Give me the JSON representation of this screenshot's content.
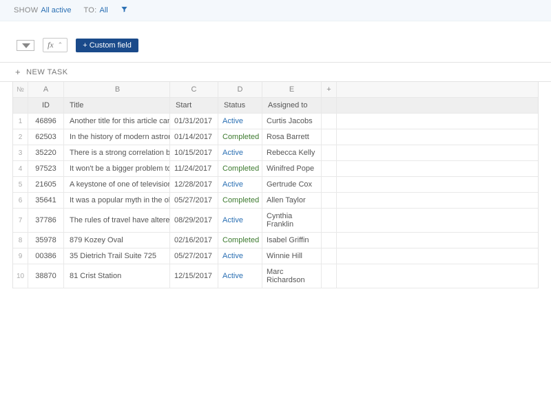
{
  "filters": {
    "show_label": "SHOW",
    "show_value": "All active",
    "to_label": "TO:",
    "to_value": "All"
  },
  "toolbar": {
    "fx_label": "fx",
    "custom_field_btn": "+ Custom field"
  },
  "new_task": {
    "label": "NEW TASK"
  },
  "headers": {
    "num": "№",
    "id": "ID",
    "title": "Title",
    "start": "Start",
    "status": "Status",
    "assigned": "Assigned to"
  },
  "letters": {
    "a": "A",
    "b": "B",
    "c": "C",
    "d": "D",
    "e": "E",
    "plus": "+"
  },
  "rows": [
    {
      "n": "1",
      "id": "46896",
      "title": "Another title for this article can",
      "start": "01/31/2017",
      "status": "Active",
      "assigned": "Curtis Jacobs"
    },
    {
      "n": "2",
      "id": "62503",
      "title": "In the history of modern astron Mike was...",
      "start": "01/14/2017",
      "status": "Completed",
      "assigned": "Rosa Barrett"
    },
    {
      "n": "3",
      "id": "35220",
      "title": "There is a strong correlation between pop...",
      "start": "10/15/2017",
      "status": "Active",
      "assigned": "Rebecca Kelly"
    },
    {
      "n": "4",
      "id": "97523",
      "title": "It won't be a bigger problem to increase c...",
      "start": "11/24/2017",
      "status": "Completed",
      "assigned": "Winifred Pope"
    },
    {
      "n": "5",
      "id": "21605",
      "title": "A keystone of one of television's misson is...",
      "start": "12/28/2017",
      "status": "Active",
      "assigned": "Gertrude Cox"
    },
    {
      "n": "6",
      "id": "35641",
      "title": "It was a popular myth in the old city where...",
      "start": "05/27/2017",
      "status": "Completed",
      "assigned": "Allen Taylor"
    },
    {
      "n": "7",
      "id": "37786",
      "title": "The rules of travel have altered to what you",
      "start": "08/29/2017",
      "status": "Active",
      "assigned": "Cynthia Franklin"
    },
    {
      "n": "8",
      "id": "35978",
      "title": "879 Kozey Oval",
      "start": "02/16/2017",
      "status": "Completed",
      "assigned": "Isabel Griffin"
    },
    {
      "n": "9",
      "id": "00386",
      "title": "35 Dietrich Trail Suite 725",
      "start": "05/27/2017",
      "status": "Active",
      "assigned": "Winnie Hill"
    },
    {
      "n": "10",
      "id": "38870",
      "title": "81 Crist Station",
      "start": "12/15/2017",
      "status": "Active",
      "assigned": "Marc Richardson"
    }
  ]
}
